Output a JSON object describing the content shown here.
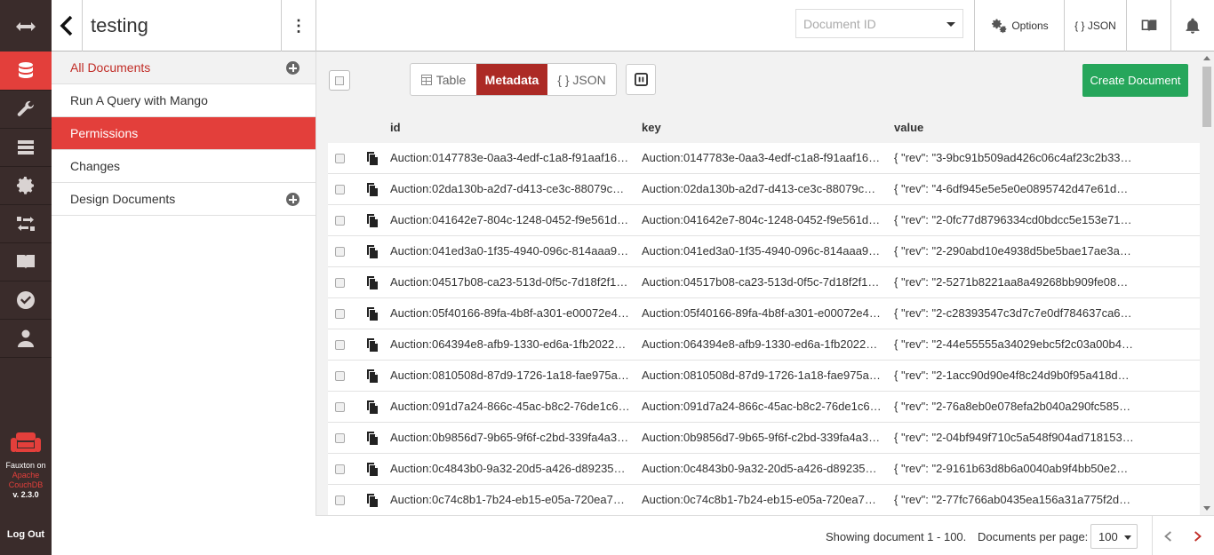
{
  "sidebar_brand": {
    "line1": "Fauxton on",
    "line2": "Apache",
    "line3": "CouchDB",
    "version": "v. 2.3.0",
    "logout": "Log Out"
  },
  "header": {
    "title": "testing",
    "docid_placeholder": "Document ID",
    "options_label": "Options",
    "json_label": "{ } JSON"
  },
  "sidebar": {
    "items": [
      {
        "label": "All Documents",
        "state": "current"
      },
      {
        "label": "Run A Query with Mango",
        "state": "normal"
      },
      {
        "label": "Permissions",
        "state": "active"
      },
      {
        "label": "Changes",
        "state": "normal"
      },
      {
        "label": "Design Documents",
        "state": "normal"
      }
    ]
  },
  "toolbar": {
    "table_label": "Table",
    "metadata_label": "Metadata",
    "json_label": "{ } JSON",
    "create_label": "Create Document"
  },
  "table": {
    "columns": [
      "id",
      "key",
      "value"
    ],
    "rows": [
      {
        "id": "Auction:0147783e-0aa3-4edf-c1a8-f91aaf16e…",
        "key": "Auction:0147783e-0aa3-4edf-c1a8-f91aaf16e…",
        "value": "{ \"rev\": \"3-9bc91b509ad426c06c4af23c2b338…"
      },
      {
        "id": "Auction:02da130b-a2d7-d413-ce3c-88079ca…",
        "key": "Auction:02da130b-a2d7-d413-ce3c-88079ca0…",
        "value": "{ \"rev\": \"4-6df945e5e5e0e0895742d47e61d65…"
      },
      {
        "id": "Auction:041642e7-804c-1248-0452-f9e561d5…",
        "key": "Auction:041642e7-804c-1248-0452-f9e561d5…",
        "value": "{ \"rev\": \"2-0fc77d8796334cd0bdcc5e153e717…"
      },
      {
        "id": "Auction:041ed3a0-1f35-4940-096c-814aaa92…",
        "key": "Auction:041ed3a0-1f35-4940-096c-814aaa92…",
        "value": "{ \"rev\": \"2-290abd10e4938d5be5bae17ae3a0…"
      },
      {
        "id": "Auction:04517b08-ca23-513d-0f5c-7d18f2f12…",
        "key": "Auction:04517b08-ca23-513d-0f5c-7d18f2f12…",
        "value": "{ \"rev\": \"2-5271b8221aa8a49268bb909fe0809…"
      },
      {
        "id": "Auction:05f40166-89fa-4b8f-a301-e00072e4e…",
        "key": "Auction:05f40166-89fa-4b8f-a301-e00072e4e…",
        "value": "{ \"rev\": \"2-c28393547c3d7c7e0df784637ca6b…"
      },
      {
        "id": "Auction:064394e8-afb9-1330-ed6a-1fb20222…",
        "key": "Auction:064394e8-afb9-1330-ed6a-1fb20222…",
        "value": "{ \"rev\": \"2-44e55555a34029ebc5f2c03a00b42…"
      },
      {
        "id": "Auction:0810508d-87d9-1726-1a18-fae975ac…",
        "key": "Auction:0810508d-87d9-1726-1a18-fae975ac…",
        "value": "{ \"rev\": \"2-1acc90d90e4f8c24d9b0f95a418d6…"
      },
      {
        "id": "Auction:091d7a24-866c-45ac-b8c2-76de1c68…",
        "key": "Auction:091d7a24-866c-45ac-b8c2-76de1c68…",
        "value": "{ \"rev\": \"2-76a8eb0e078efa2b040a290fc5856…"
      },
      {
        "id": "Auction:0b9856d7-9b65-9f6f-c2bd-339fa4a32…",
        "key": "Auction:0b9856d7-9b65-9f6f-c2bd-339fa4a32…",
        "value": "{ \"rev\": \"2-04bf949f710c5a548f904ad718153c…"
      },
      {
        "id": "Auction:0c4843b0-9a32-20d5-a426-d892350…",
        "key": "Auction:0c4843b0-9a32-20d5-a426-d892350…",
        "value": "{ \"rev\": \"2-9161b63d8b6a0040ab9f4bb50e260…"
      },
      {
        "id": "Auction:0c74c8b1-7b24-eb15-e05a-720ea72…",
        "key": "Auction:0c74c8b1-7b24-eb15-e05a-720ea72…",
        "value": "{ \"rev\": \"2-77fc766ab0435ea156a31a775f2d5…"
      }
    ]
  },
  "footer": {
    "showing": "Showing document 1 - 100.",
    "per_page_label": "Documents per page:",
    "per_page_value": "100"
  },
  "colors": {
    "nav_bg": "#3a2c2b",
    "accent_red": "#e33f3b",
    "metadata_red": "#ac2a25",
    "create_green": "#26a65b"
  }
}
